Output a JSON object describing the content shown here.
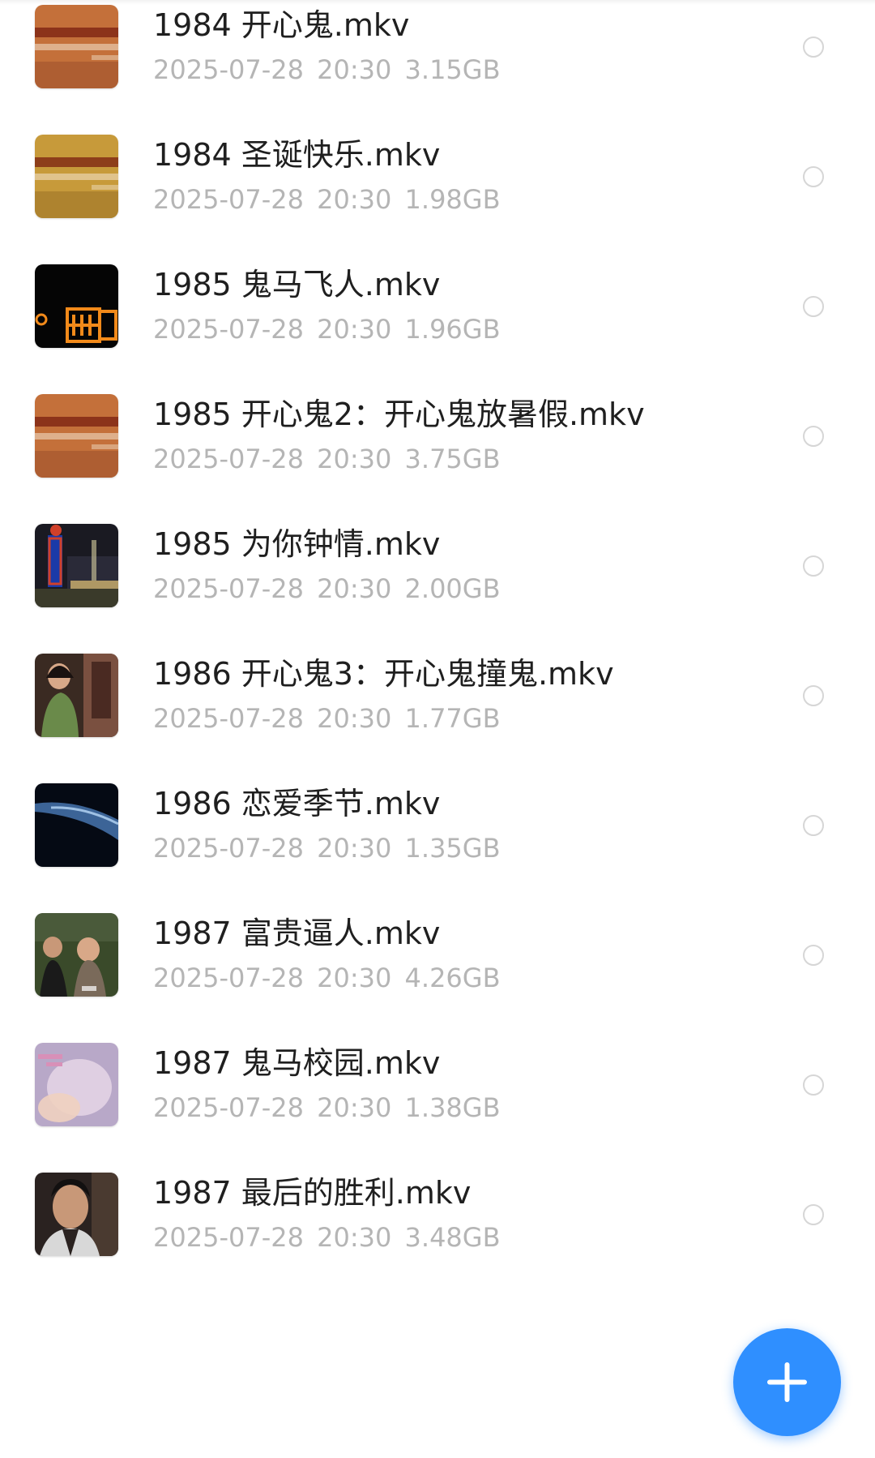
{
  "files": [
    {
      "name": "1984 开心鬼.mkv",
      "date": "2025-07-28",
      "time": "20:30",
      "size": "3.15GB",
      "thumbnail_icon": "film-studio-logo-thumbnail",
      "thumbnail_colors": [
        "#c4703a",
        "#a0522d"
      ]
    },
    {
      "name": "1984 圣诞快乐.mkv",
      "date": "2025-07-28",
      "time": "20:30",
      "size": "1.98GB",
      "thumbnail_icon": "film-studio-logo-thumbnail",
      "thumbnail_colors": [
        "#c79a3a",
        "#9c7428"
      ]
    },
    {
      "name": "1985 鬼马飞人.mkv",
      "date": "2025-07-28",
      "time": "20:30",
      "size": "1.96GB",
      "thumbnail_icon": "neon-sign-thumbnail",
      "thumbnail_colors": [
        "#050505",
        "#f28a1a"
      ]
    },
    {
      "name": "1985 开心鬼2：开心鬼放暑假.mkv",
      "date": "2025-07-28",
      "time": "20:30",
      "size": "3.75GB",
      "thumbnail_icon": "film-studio-logo-thumbnail",
      "thumbnail_colors": [
        "#c4703a",
        "#a0522d"
      ]
    },
    {
      "name": "1985 为你钟情.mkv",
      "date": "2025-07-28",
      "time": "20:30",
      "size": "2.00GB",
      "thumbnail_icon": "night-street-thumbnail",
      "thumbnail_colors": [
        "#1a1a22",
        "#d0402a"
      ]
    },
    {
      "name": "1986 开心鬼3：开心鬼撞鬼.mkv",
      "date": "2025-07-28",
      "time": "20:30",
      "size": "1.77GB",
      "thumbnail_icon": "woman-phone-booth-thumbnail",
      "thumbnail_colors": [
        "#6a8a4a",
        "#3a2a22"
      ]
    },
    {
      "name": "1986 恋爱季节.mkv",
      "date": "2025-07-28",
      "time": "20:30",
      "size": "1.35GB",
      "thumbnail_icon": "dark-blue-scene-thumbnail",
      "thumbnail_colors": [
        "#050a14",
        "#4a7ab8"
      ]
    },
    {
      "name": "1987 富贵逼人.mkv",
      "date": "2025-07-28",
      "time": "20:30",
      "size": "4.26GB",
      "thumbnail_icon": "family-scene-thumbnail",
      "thumbnail_colors": [
        "#3a4a2a",
        "#7a6a5a"
      ]
    },
    {
      "name": "1987 鬼马校园.mkv",
      "date": "2025-07-28",
      "time": "20:30",
      "size": "1.38GB",
      "thumbnail_icon": "pink-title-thumbnail",
      "thumbnail_colors": [
        "#b8a8c8",
        "#d890b8"
      ]
    },
    {
      "name": "1987 最后的胜利.mkv",
      "date": "2025-07-28",
      "time": "20:30",
      "size": "3.48GB",
      "thumbnail_icon": "man-portrait-thumbnail",
      "thumbnail_colors": [
        "#2a2220",
        "#c89878"
      ]
    }
  ],
  "fab": {
    "icon": "plus-icon",
    "color": "#2f8fff"
  },
  "colors": {
    "name_text": "#1f1f1f",
    "meta_text": "#b5b5b5",
    "radio_border": "#d6d6d6"
  }
}
